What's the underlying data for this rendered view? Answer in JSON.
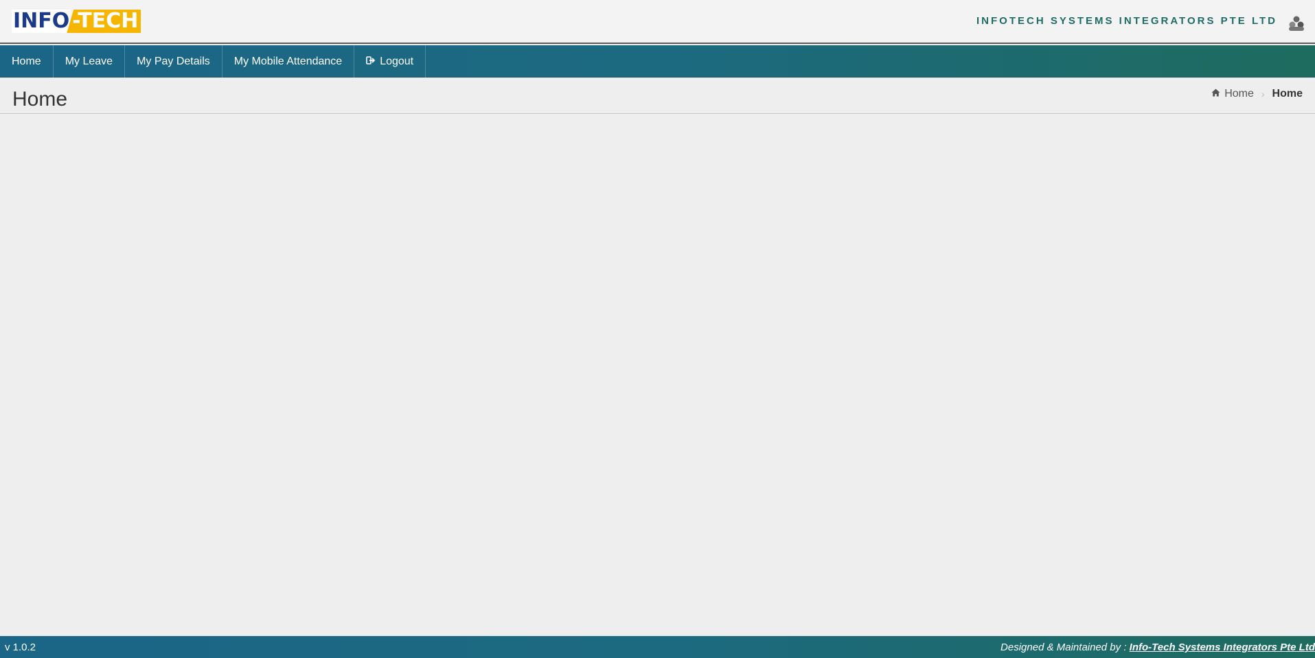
{
  "header": {
    "logo_part1": "INFO",
    "logo_part2": "-TECH",
    "company_name": "INFOTECH SYSTEMS INTEGRATORS PTE LTD",
    "company_icon": "users-icon"
  },
  "nav": {
    "items": [
      {
        "label": "Home"
      },
      {
        "label": "My Leave"
      },
      {
        "label": "My Pay Details"
      },
      {
        "label": "My Mobile Attendance"
      },
      {
        "label": "Logout",
        "icon": "sign-out-icon"
      }
    ]
  },
  "page": {
    "title": "Home",
    "breadcrumb": {
      "home_label": "Home",
      "current": "Home"
    }
  },
  "footer": {
    "version": "v 1.0.2",
    "credit_prefix": "Designed & Maintained by : ",
    "credit_link": "Info-Tech Systems Integrators Pte Ltd"
  },
  "colors": {
    "nav_start": "#1b6587",
    "nav_end": "#1e6b5f",
    "company_text": "#1f6b66",
    "logo_blue": "#1b3a8a",
    "logo_yellow": "#f6b500"
  }
}
